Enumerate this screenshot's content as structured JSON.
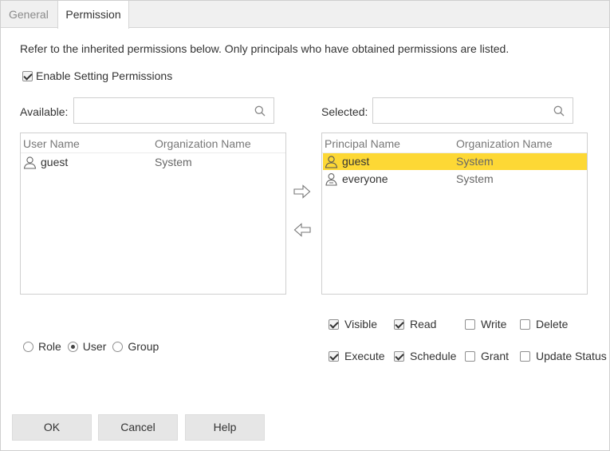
{
  "tabs": [
    {
      "label": "General",
      "active": false
    },
    {
      "label": "Permission",
      "active": true
    }
  ],
  "intro_text": "Refer to the inherited permissions below. Only principals who have obtained permissions are listed.",
  "enable_setting": {
    "label": "Enable Setting Permissions",
    "checked": true
  },
  "available": {
    "label": "Available:",
    "search_value": "",
    "columns": [
      "User Name",
      "Organization Name"
    ],
    "rows": [
      {
        "name": "guest",
        "org": "System",
        "icon": "user-icon"
      }
    ]
  },
  "selected": {
    "label": "Selected:",
    "search_value": "",
    "columns": [
      "Principal Name",
      "Organization Name"
    ],
    "rows": [
      {
        "name": "guest",
        "org": "System",
        "icon": "user-icon",
        "selected": true
      },
      {
        "name": "everyone",
        "org": "System",
        "icon": "everyone-icon",
        "selected": false
      }
    ]
  },
  "principal_type": {
    "options": [
      "Role",
      "User",
      "Group"
    ],
    "selected": "User"
  },
  "permissions": [
    {
      "label": "Visible",
      "checked": true
    },
    {
      "label": "Read",
      "checked": true
    },
    {
      "label": "Write",
      "checked": false
    },
    {
      "label": "Delete",
      "checked": false
    },
    {
      "label": "Execute",
      "checked": true
    },
    {
      "label": "Schedule",
      "checked": true
    },
    {
      "label": "Grant",
      "checked": false
    },
    {
      "label": "Update Status",
      "checked": false
    }
  ],
  "buttons": {
    "ok": "OK",
    "cancel": "Cancel",
    "help": "Help"
  },
  "colors": {
    "selected_row": "#fdd835",
    "tab_bar": "#f0f0f0",
    "button": "#e6e6e6"
  }
}
